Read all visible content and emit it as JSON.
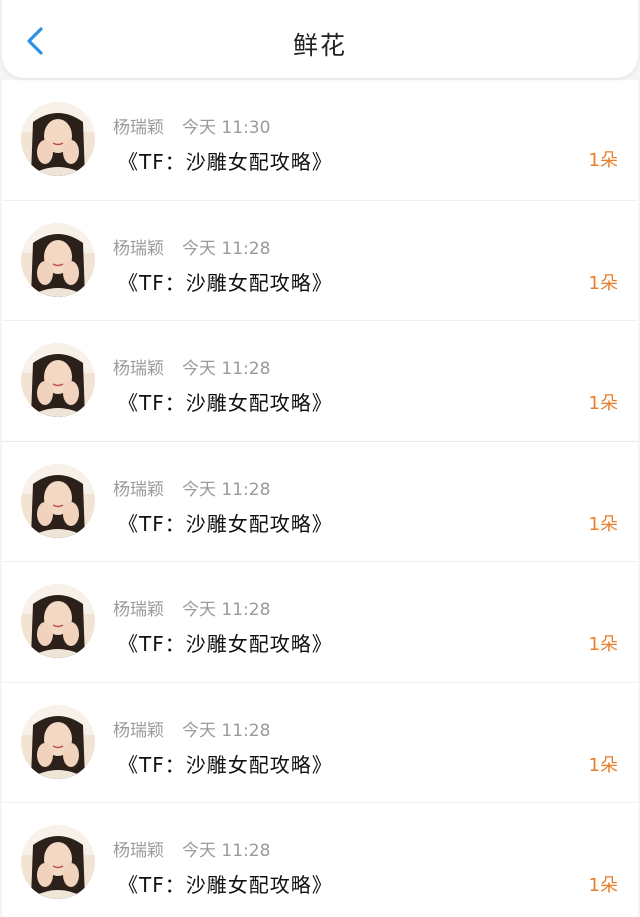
{
  "header": {
    "title": "鲜花",
    "back_icon": "chevron-left-icon",
    "accent_color": "#2e8fe6"
  },
  "rows": [
    {
      "name": "杨瑞颖",
      "time": "今天 11:30",
      "book": "《TF：沙雕女配攻略》",
      "amount": "1朵"
    },
    {
      "name": "杨瑞颖",
      "time": "今天 11:28",
      "book": "《TF：沙雕女配攻略》",
      "amount": "1朵"
    },
    {
      "name": "杨瑞颖",
      "time": "今天 11:28",
      "book": "《TF：沙雕女配攻略》",
      "amount": "1朵"
    },
    {
      "name": "杨瑞颖",
      "time": "今天 11:28",
      "book": "《TF：沙雕女配攻略》",
      "amount": "1朵"
    },
    {
      "name": "杨瑞颖",
      "time": "今天 11:28",
      "book": "《TF：沙雕女配攻略》",
      "amount": "1朵"
    },
    {
      "name": "杨瑞颖",
      "time": "今天 11:28",
      "book": "《TF：沙雕女配攻略》",
      "amount": "1朵"
    },
    {
      "name": "杨瑞颖",
      "time": "今天 11:28",
      "book": "《TF：沙雕女配攻略》",
      "amount": "1朵"
    }
  ],
  "colors": {
    "amount": "#e87f2d",
    "meta": "#9a9a9a"
  }
}
